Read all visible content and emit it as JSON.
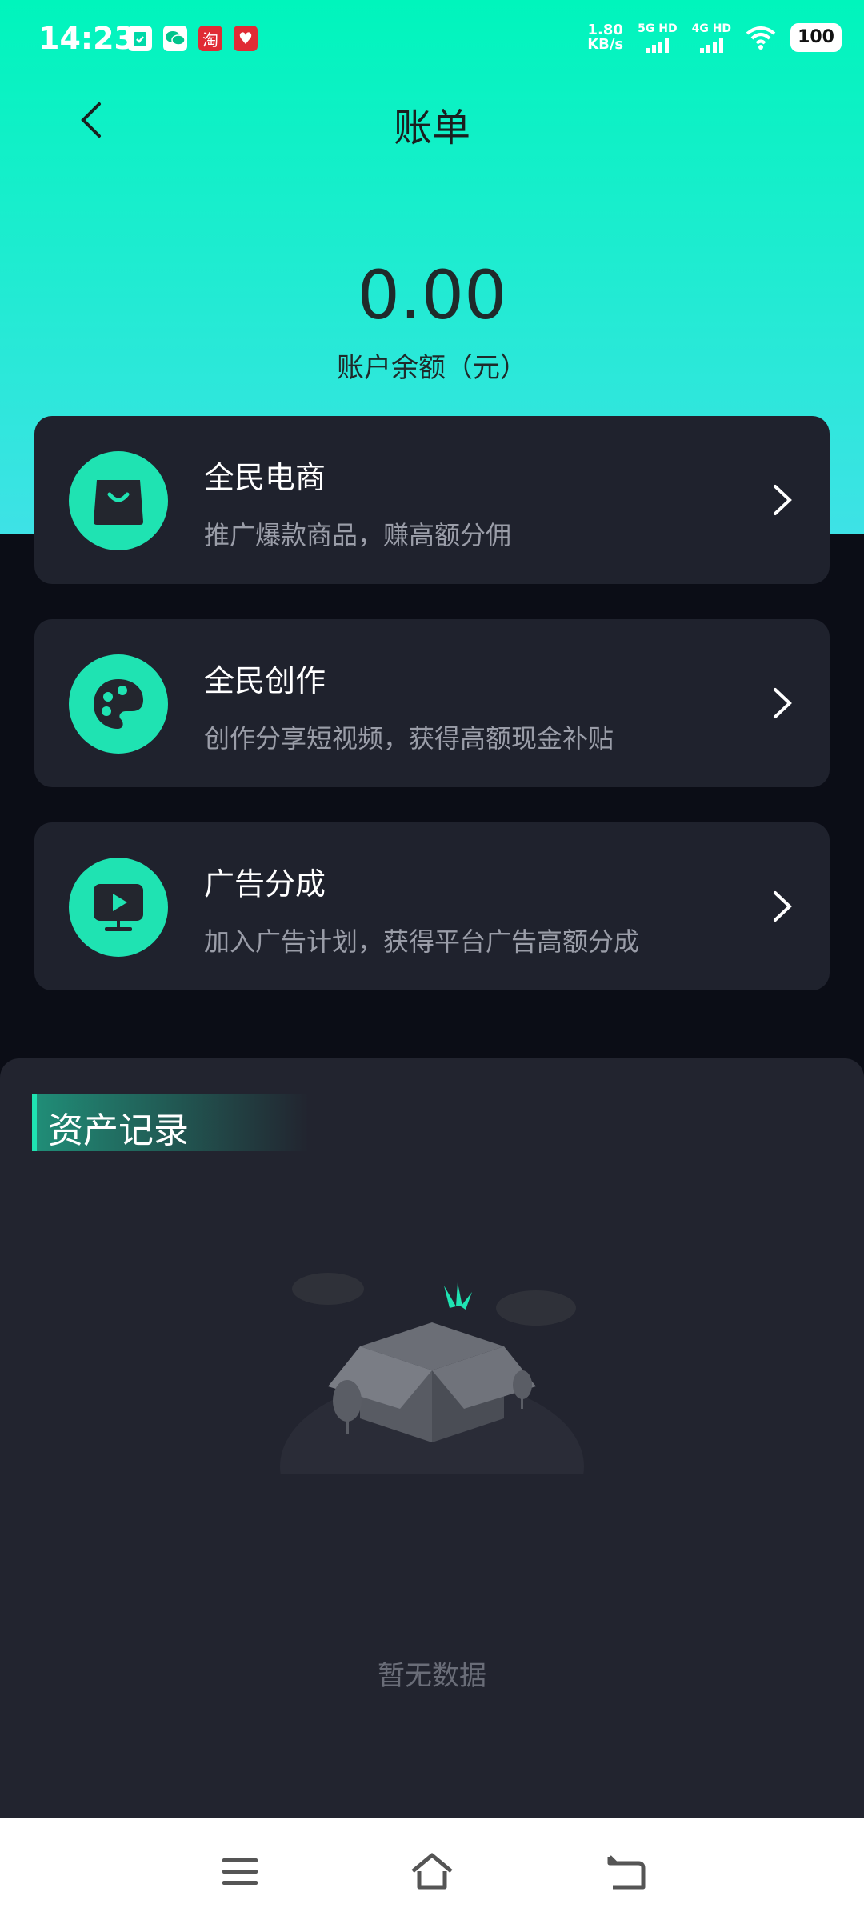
{
  "status_bar": {
    "time": "14:23",
    "net_speed_value": "1.80",
    "net_speed_unit": "KB/s",
    "sim1": "5G HD",
    "sim2": "4G HD",
    "battery": "100"
  },
  "nav": {
    "title": "账单"
  },
  "balance": {
    "amount": "0.00",
    "label": "账户余额（元）"
  },
  "cards": [
    {
      "title": "全民电商",
      "subtitle": "推广爆款商品，赚高额分佣",
      "icon": "shopping-bag-icon"
    },
    {
      "title": "全民创作",
      "subtitle": "创作分享短视频，获得高额现金补贴",
      "icon": "palette-icon"
    },
    {
      "title": "广告分成",
      "subtitle": "加入广告计划，获得平台广告高额分成",
      "icon": "video-play-icon"
    }
  ],
  "records": {
    "title": "资产记录",
    "empty_text": "暂无数据"
  },
  "colors": {
    "accent": "#1fe3b2",
    "card_bg": "#1f222d",
    "page_bg": "#0b0d16"
  }
}
